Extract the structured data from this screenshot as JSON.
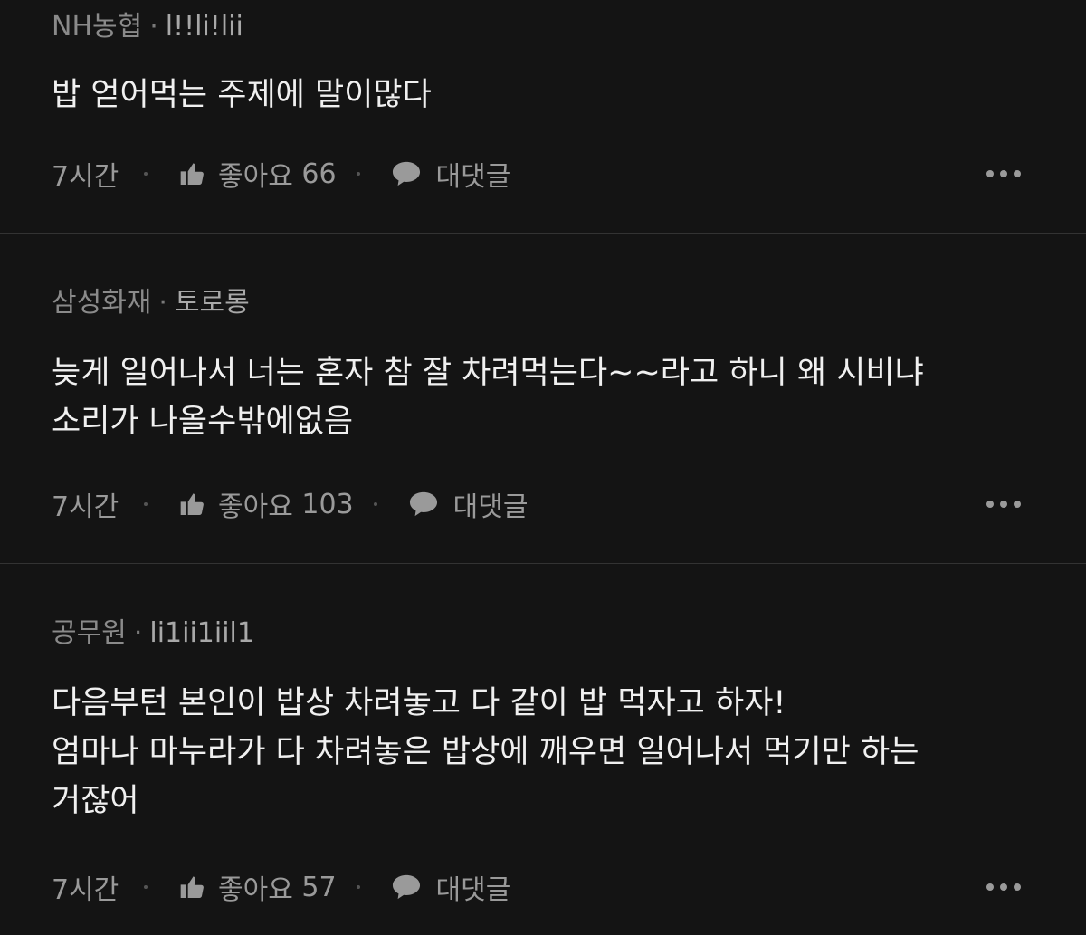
{
  "comments": [
    {
      "company": "NH농협",
      "nickname": "l!!li!lii",
      "text": "밥 얻어먹는 주제에 말이많다",
      "time": "7시간",
      "like_label": "좋아요",
      "like_count": "66",
      "reply_label": "대댓글"
    },
    {
      "company": "삼성화재",
      "nickname": "토로롱",
      "text": "늦게 일어나서 너는 혼자 참 잘 차려먹는다~~라고 하니 왜 시비냐\n소리가 나올수밖에없음",
      "time": "7시간",
      "like_label": "좋아요",
      "like_count": "103",
      "reply_label": "대댓글"
    },
    {
      "company": "공무원",
      "nickname": "li1ii1iil1",
      "text": "다음부턴 본인이 밥상 차려놓고 다 같이 밥 먹자고 하자!\n엄마나 마누라가 다 차려놓은 밥상에 깨우면 일어나서 먹기만 하는\n거잖어",
      "time": "7시간",
      "like_label": "좋아요",
      "like_count": "57",
      "reply_label": "대댓글"
    }
  ],
  "colors": {
    "background": "#141414",
    "text": "#f0f0f0",
    "meta": "#8a8a8a",
    "divider": "#333333"
  },
  "icons": [
    "thumbs-up-icon",
    "speech-bubble-icon",
    "more-dots-icon"
  ]
}
